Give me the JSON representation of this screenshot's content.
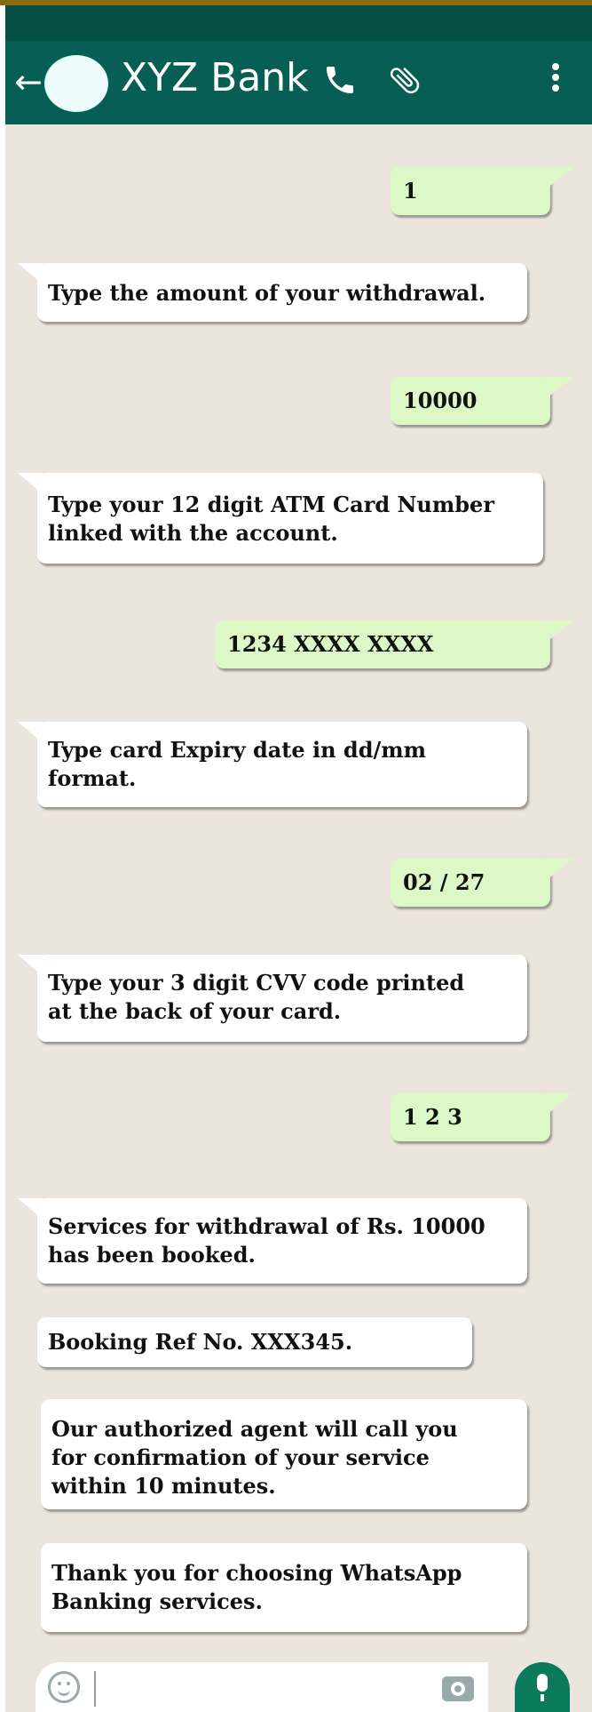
{
  "header": {
    "title": "XYZ Bank",
    "back_icon": "arrow-left-icon",
    "call_icon": "phone-icon",
    "attach_icon": "paperclip-icon",
    "menu_icon": "more-vertical-icon"
  },
  "messages": [
    {
      "from": "user",
      "text": "1"
    },
    {
      "from": "bank",
      "text": "Type the amount of your withdrawal."
    },
    {
      "from": "user",
      "text": "10000"
    },
    {
      "from": "bank",
      "line1": "Type your 12 digit ATM Card Number",
      "line2": "linked with the account."
    },
    {
      "from": "user",
      "text": "1234 XXXX XXXX"
    },
    {
      "from": "bank",
      "line1": "Type card Expiry date in dd/mm",
      "line2": "format."
    },
    {
      "from": "user",
      "text": "02 / 27"
    },
    {
      "from": "bank",
      "line1": "Type your 3 digit CVV code printed",
      "line2": "at the back of your card."
    },
    {
      "from": "user",
      "text": "1 2 3"
    },
    {
      "from": "bank",
      "line1": "Services for withdrawal of Rs. 10000",
      "line2": "has been booked."
    },
    {
      "from": "bank",
      "text": "Booking Ref No. XXX345."
    },
    {
      "from": "bank",
      "line1": "Our authorized agent will call you",
      "line2": "for confirmation of your service",
      "line3": "within 10 minutes."
    },
    {
      "from": "bank",
      "line1": "Thank you for choosing WhatsApp",
      "line2": "Banking services."
    }
  ],
  "composer": {
    "emoji_icon": "smiley-icon",
    "camera_icon": "camera-icon",
    "mic_icon": "microphone-icon"
  },
  "colors": {
    "header": "#075e54",
    "chat_background": "#ece5dd",
    "outgoing_bubble": "#dcf8c6",
    "incoming_bubble": "#ffffff",
    "mic_button": "#0b7a5c"
  }
}
